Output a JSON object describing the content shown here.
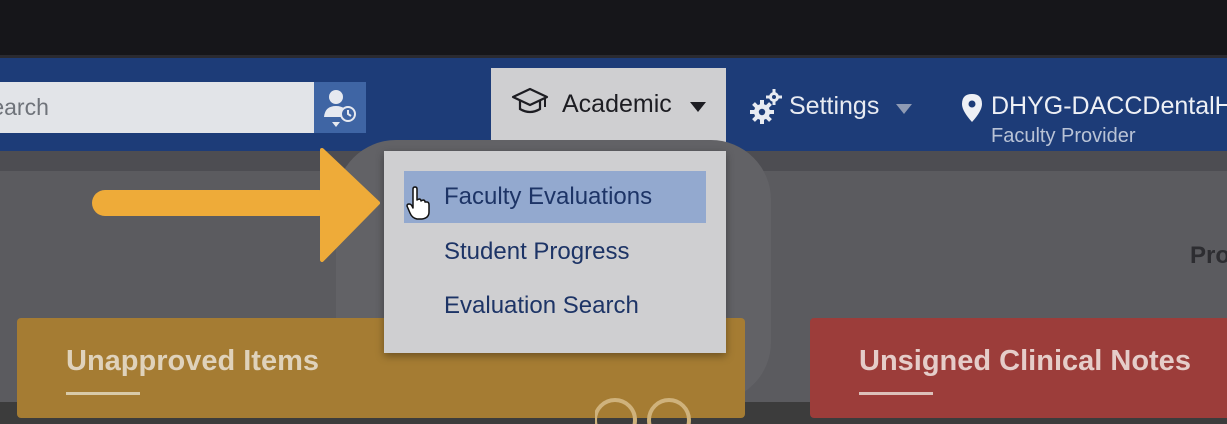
{
  "search": {
    "placeholder": "Search"
  },
  "nav": {
    "academic_label": "Academic",
    "settings_label": "Settings",
    "location_name": "DHYG-DACCDentalH",
    "location_role": "Faculty Provider"
  },
  "academic_menu": {
    "items": [
      {
        "label": "Faculty Evaluations",
        "active": true
      },
      {
        "label": "Student Progress",
        "active": false
      },
      {
        "label": "Evaluation Search",
        "active": false
      }
    ]
  },
  "dashboard": {
    "partial_label": "Pro",
    "cards": [
      {
        "title": "Unapproved Items",
        "color": "#a57c33"
      },
      {
        "title": "Unsigned Clinical Notes",
        "color": "#9c3d3a"
      }
    ]
  },
  "colors": {
    "navbar": "#1d3c78",
    "accent_button": "#3f65a4",
    "menu_highlight": "#93a9cf",
    "annotation_arrow": "#eeab39"
  },
  "icons": {
    "patient_search": "patient-history-icon",
    "academic": "graduation-cap-icon",
    "settings": "gears-icon",
    "location": "map-pin-icon",
    "cursor": "hand-pointer-icon"
  }
}
